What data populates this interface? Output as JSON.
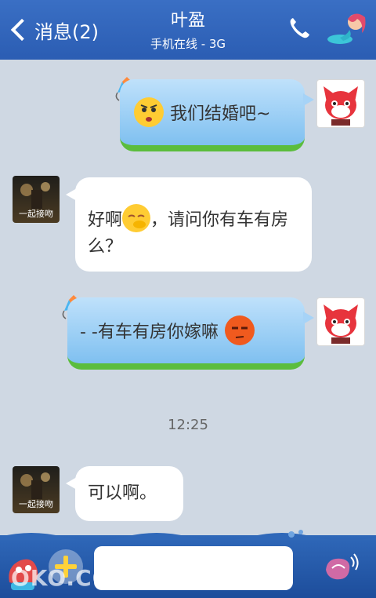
{
  "header": {
    "back_label": "消息(2)",
    "title": "叶盈",
    "subtitle": "手机在线 - 3G"
  },
  "messages": [
    {
      "side": "sent",
      "text": "我们结婚吧~",
      "emoji": "frowning-face-icon"
    },
    {
      "side": "received",
      "text_a": "好啊",
      "text_b": "，请问你有车有房么？",
      "emoji": "shy-face-icon",
      "avatar_label": "一起接吻"
    },
    {
      "side": "sent",
      "text": "- -有车有房你嫁嘛",
      "emoji": "unamused-red-face-icon"
    },
    {
      "side": "received",
      "text": "可以啊。",
      "avatar_label": "一起接吻"
    }
  ],
  "timestamp": "12:25",
  "input": {
    "value": "",
    "placeholder": ""
  },
  "watermark": "OKO.CO",
  "colors": {
    "header": "#2b5db3",
    "chat_bg": "#cfd8e3",
    "sent_bubble": "#9fd0f5",
    "grass": "#5bbd3d"
  }
}
